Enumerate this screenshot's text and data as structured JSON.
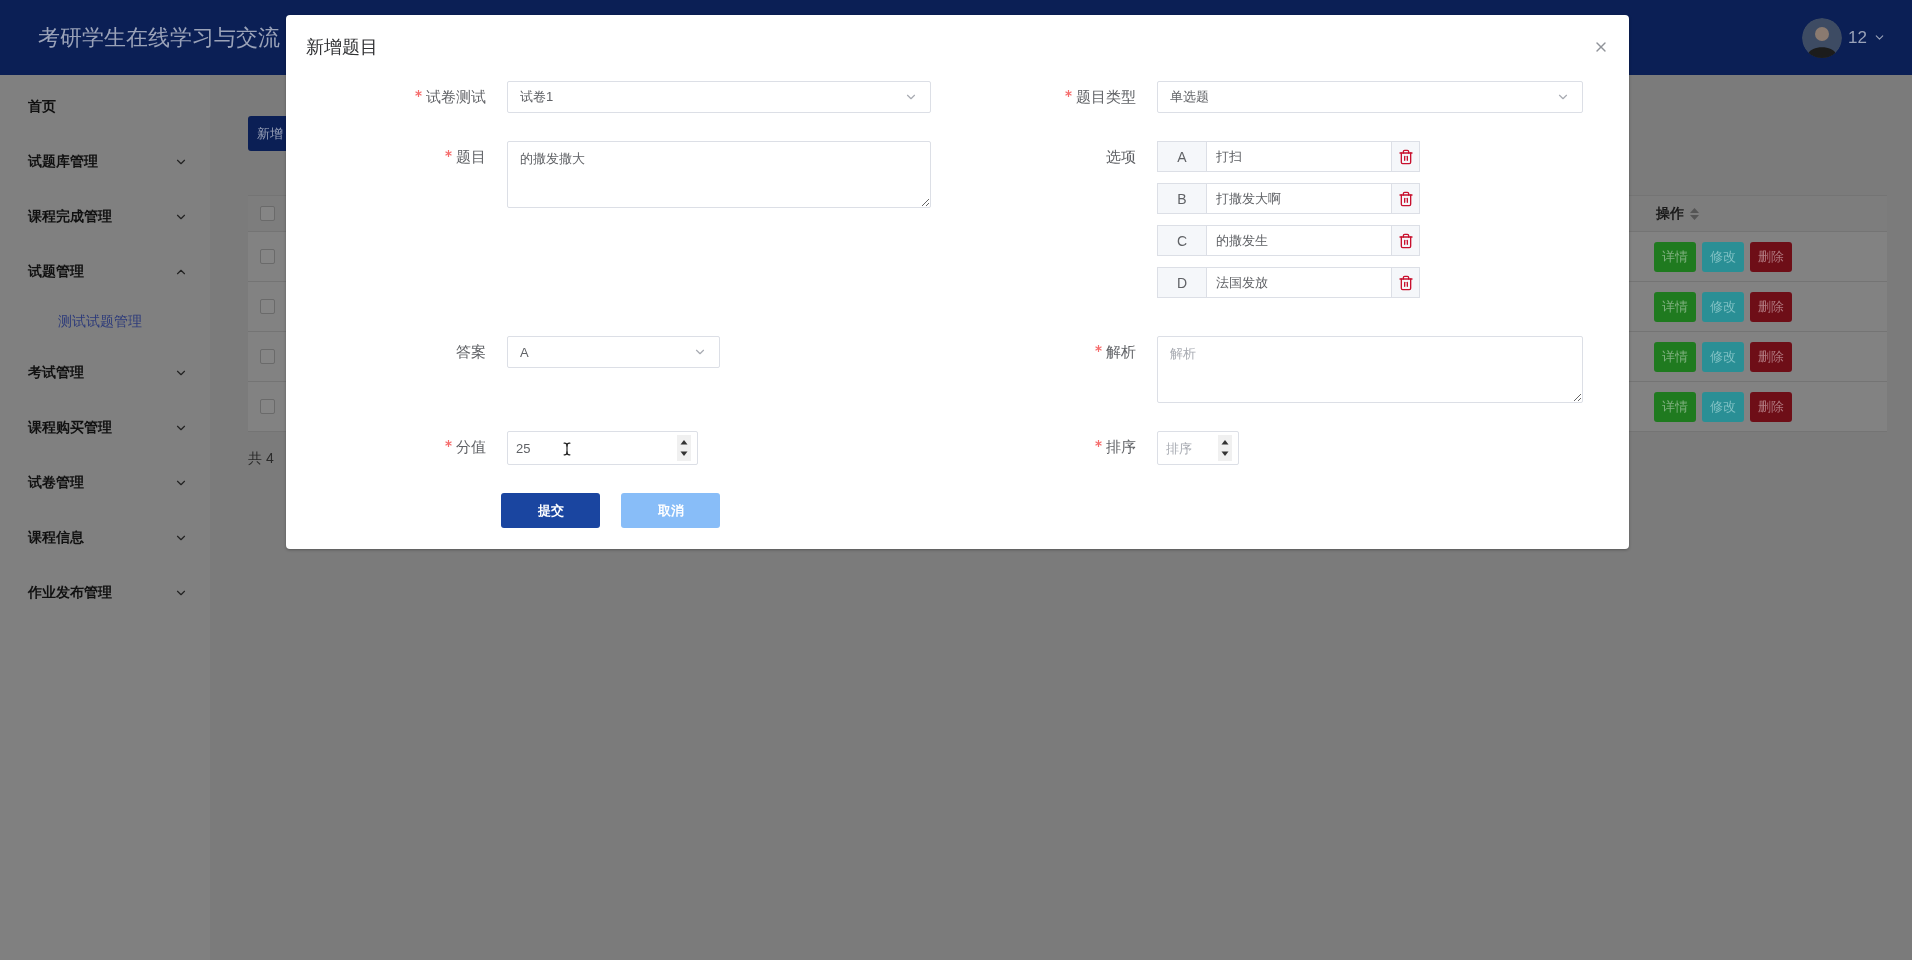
{
  "header": {
    "title": "考研学生在线学习与交流",
    "user": "12"
  },
  "sidebar": {
    "items": [
      {
        "label": "首页",
        "kind": "link"
      },
      {
        "label": "试题库管理",
        "kind": "group",
        "expanded": false
      },
      {
        "label": "课程完成管理",
        "kind": "group",
        "expanded": false
      },
      {
        "label": "试题管理",
        "kind": "group",
        "expanded": true,
        "children": [
          {
            "label": "测试试题管理",
            "selected": true
          }
        ]
      },
      {
        "label": "考试管理",
        "kind": "group",
        "expanded": false
      },
      {
        "label": "课程购买管理",
        "kind": "group",
        "expanded": false
      },
      {
        "label": "试卷管理",
        "kind": "group",
        "expanded": false
      },
      {
        "label": "课程信息",
        "kind": "group",
        "expanded": false
      },
      {
        "label": "作业发布管理",
        "kind": "group",
        "expanded": false
      }
    ]
  },
  "page": {
    "add_button": "新增",
    "table": {
      "header_checked": false,
      "columns": [
        "操作"
      ],
      "rows": [
        {
          "checked": false,
          "actions": [
            "详情",
            "修改",
            "删除"
          ]
        },
        {
          "checked": false,
          "actions": [
            "详情",
            "修改",
            "删除"
          ]
        },
        {
          "checked": false,
          "actions": [
            "详情",
            "修改",
            "删除"
          ]
        },
        {
          "checked": false,
          "actions": [
            "详情",
            "修改",
            "删除"
          ]
        }
      ]
    },
    "total": "共 4"
  },
  "dialog": {
    "title": "新增题目",
    "fields": [
      {
        "kind": "select",
        "label": "试卷测试",
        "required": true,
        "value": "试卷1"
      },
      {
        "kind": "select",
        "label": "题目类型",
        "required": true,
        "value": "单选题"
      },
      {
        "kind": "textarea",
        "label": "题目",
        "required": true,
        "value": "的撒发撒大"
      },
      {
        "kind": "options",
        "label": "选项",
        "required": false,
        "options": [
          {
            "letter": "A",
            "text": "打扫"
          },
          {
            "letter": "B",
            "text": "打撒发大啊"
          },
          {
            "letter": "C",
            "text": "的撒发生"
          },
          {
            "letter": "D",
            "text": "法国发放"
          }
        ]
      },
      {
        "kind": "select",
        "label": "答案",
        "required": false,
        "value": "A"
      },
      {
        "kind": "textarea",
        "label": "解析",
        "required": true,
        "placeholder": "解析"
      },
      {
        "kind": "number",
        "label": "分值",
        "required": true,
        "value": "25"
      },
      {
        "kind": "number",
        "label": "排序",
        "required": true,
        "placeholder": "排序"
      }
    ],
    "buttons": [
      {
        "label": "提交",
        "kind": "primary"
      },
      {
        "label": "取消",
        "kind": "secondary"
      }
    ]
  }
}
